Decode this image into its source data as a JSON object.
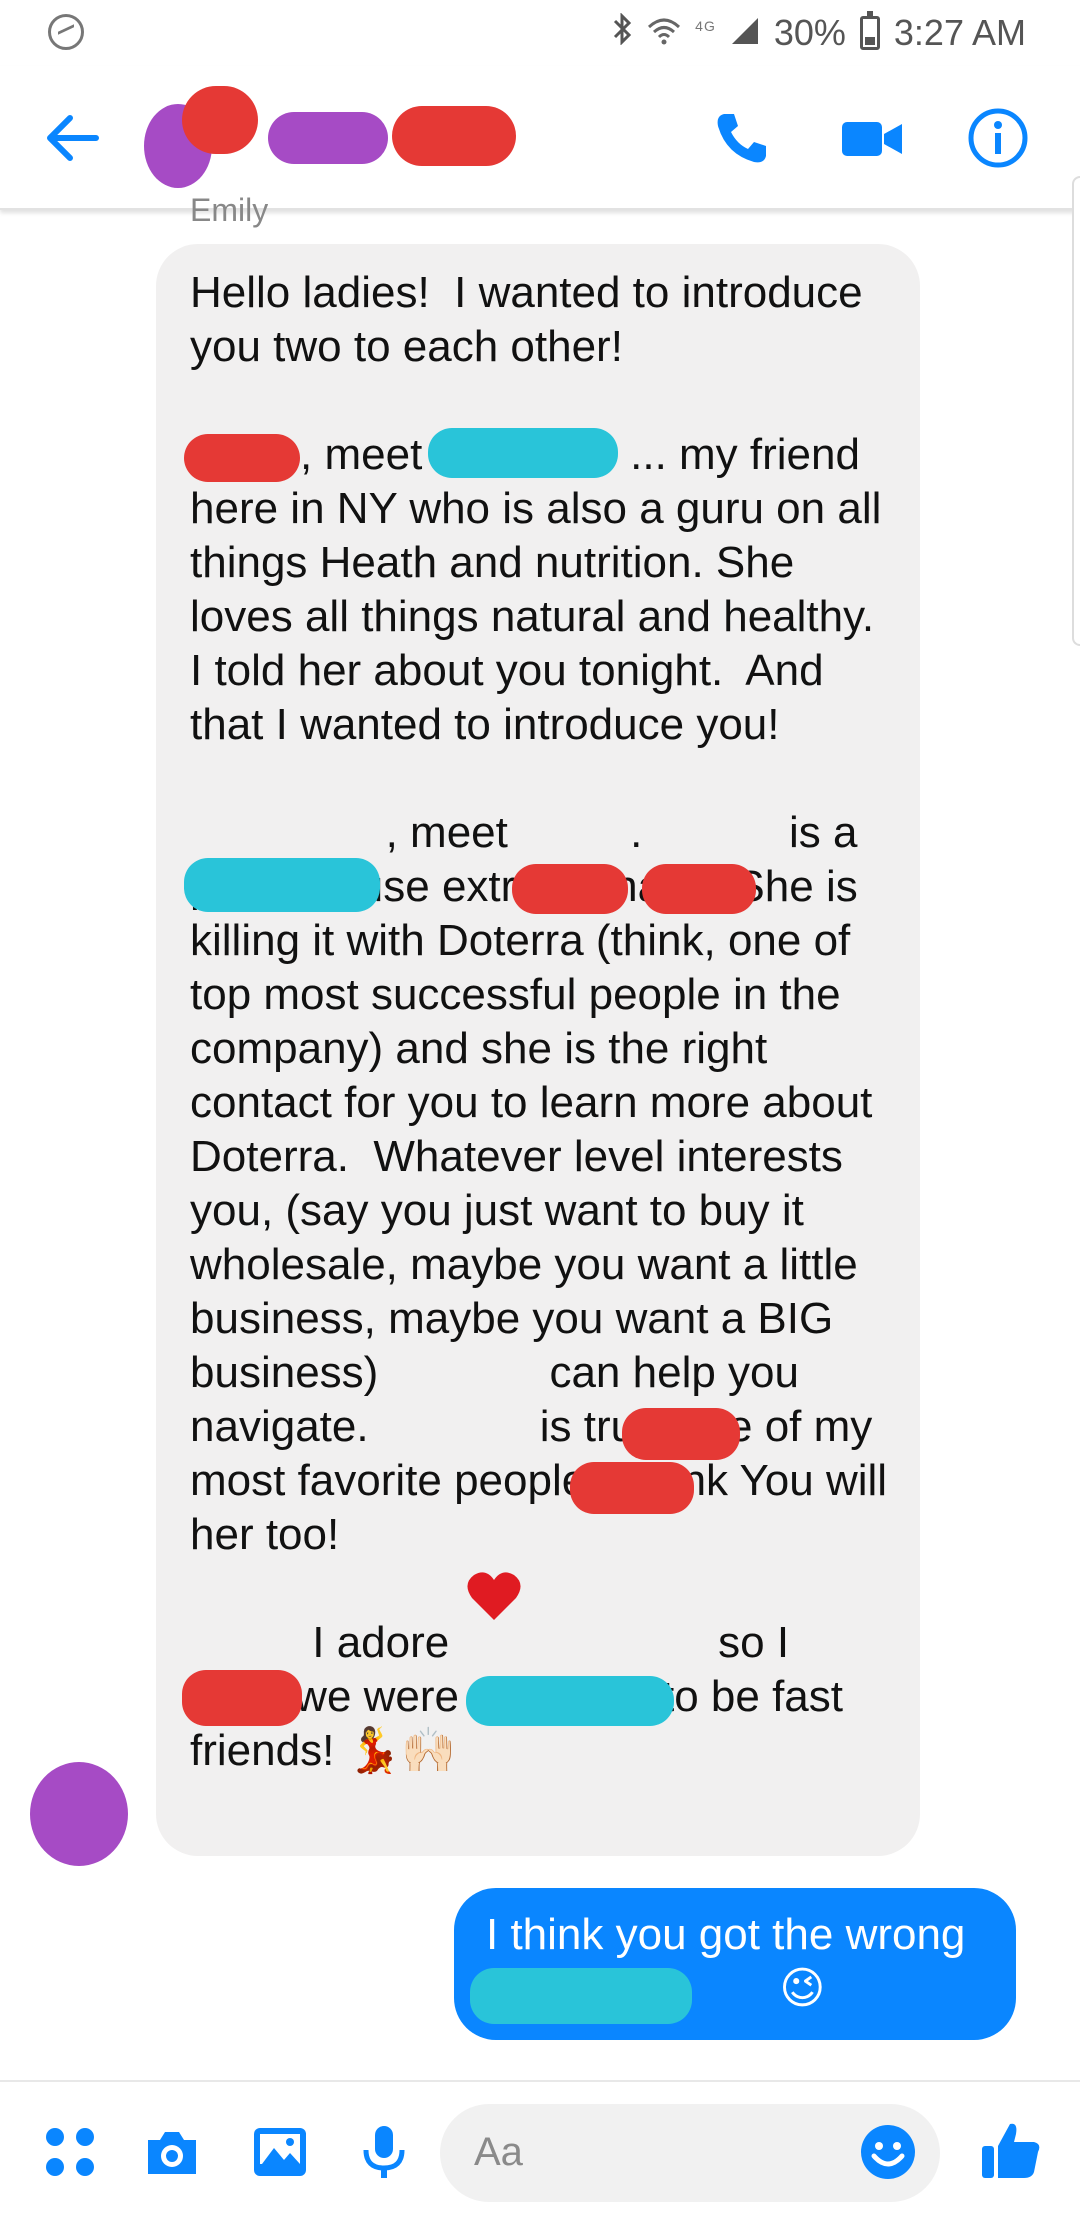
{
  "status_bar": {
    "network": "4G",
    "battery_percent": "30%",
    "battery_level": 0.3,
    "time": "3:27 AM",
    "icons": [
      "messenger-icon",
      "bluetooth-icon",
      "wifi-icon",
      "signal-icon",
      "battery-icon"
    ]
  },
  "header": {
    "icons": [
      "back-arrow-icon",
      "phone-icon",
      "video-camera-icon",
      "info-icon"
    ],
    "accent_color": "#0a86ff"
  },
  "conversation": {
    "sender_name": "Emily",
    "incoming_message": "Hello ladies!  I wanted to introduce you two to each other!\n\n         , meet                 ... my friend here in NY who is also a guru on all things Heath and nutrition. She loves all things natural and healthy. I told her about you tonight.  And that I wanted to introduce you!\n\n                , meet          .            is a powerhouse extraordinaire. She is killing it with Doterra (think, one of top most successful people in the company) and she is the right contact for you to learn more about Doterra.  Whatever level interests you, (say you just want to buy it wholesale, maybe you want a little business, maybe you want a BIG business)              can help you navigate.              is truly one of my most favorite people. I think You will      her too!\n\n          I adore                      so I think we were all meant to be fast friends! 💃🙌🏻",
    "outgoing_message": "I think you got the wrong\n                        😉"
  },
  "composer": {
    "placeholder": "Aa",
    "icons": [
      "apps-grid-icon",
      "camera-icon",
      "gallery-icon",
      "microphone-icon",
      "emoji-icon",
      "thumbs-up-icon"
    ]
  },
  "colors": {
    "bubble_incoming": "#f1f0f0",
    "bubble_outgoing": "#0a86ff",
    "redact_red": "#e53935",
    "redact_purple": "#a64bc5",
    "redact_cyan": "#29c4d9"
  }
}
